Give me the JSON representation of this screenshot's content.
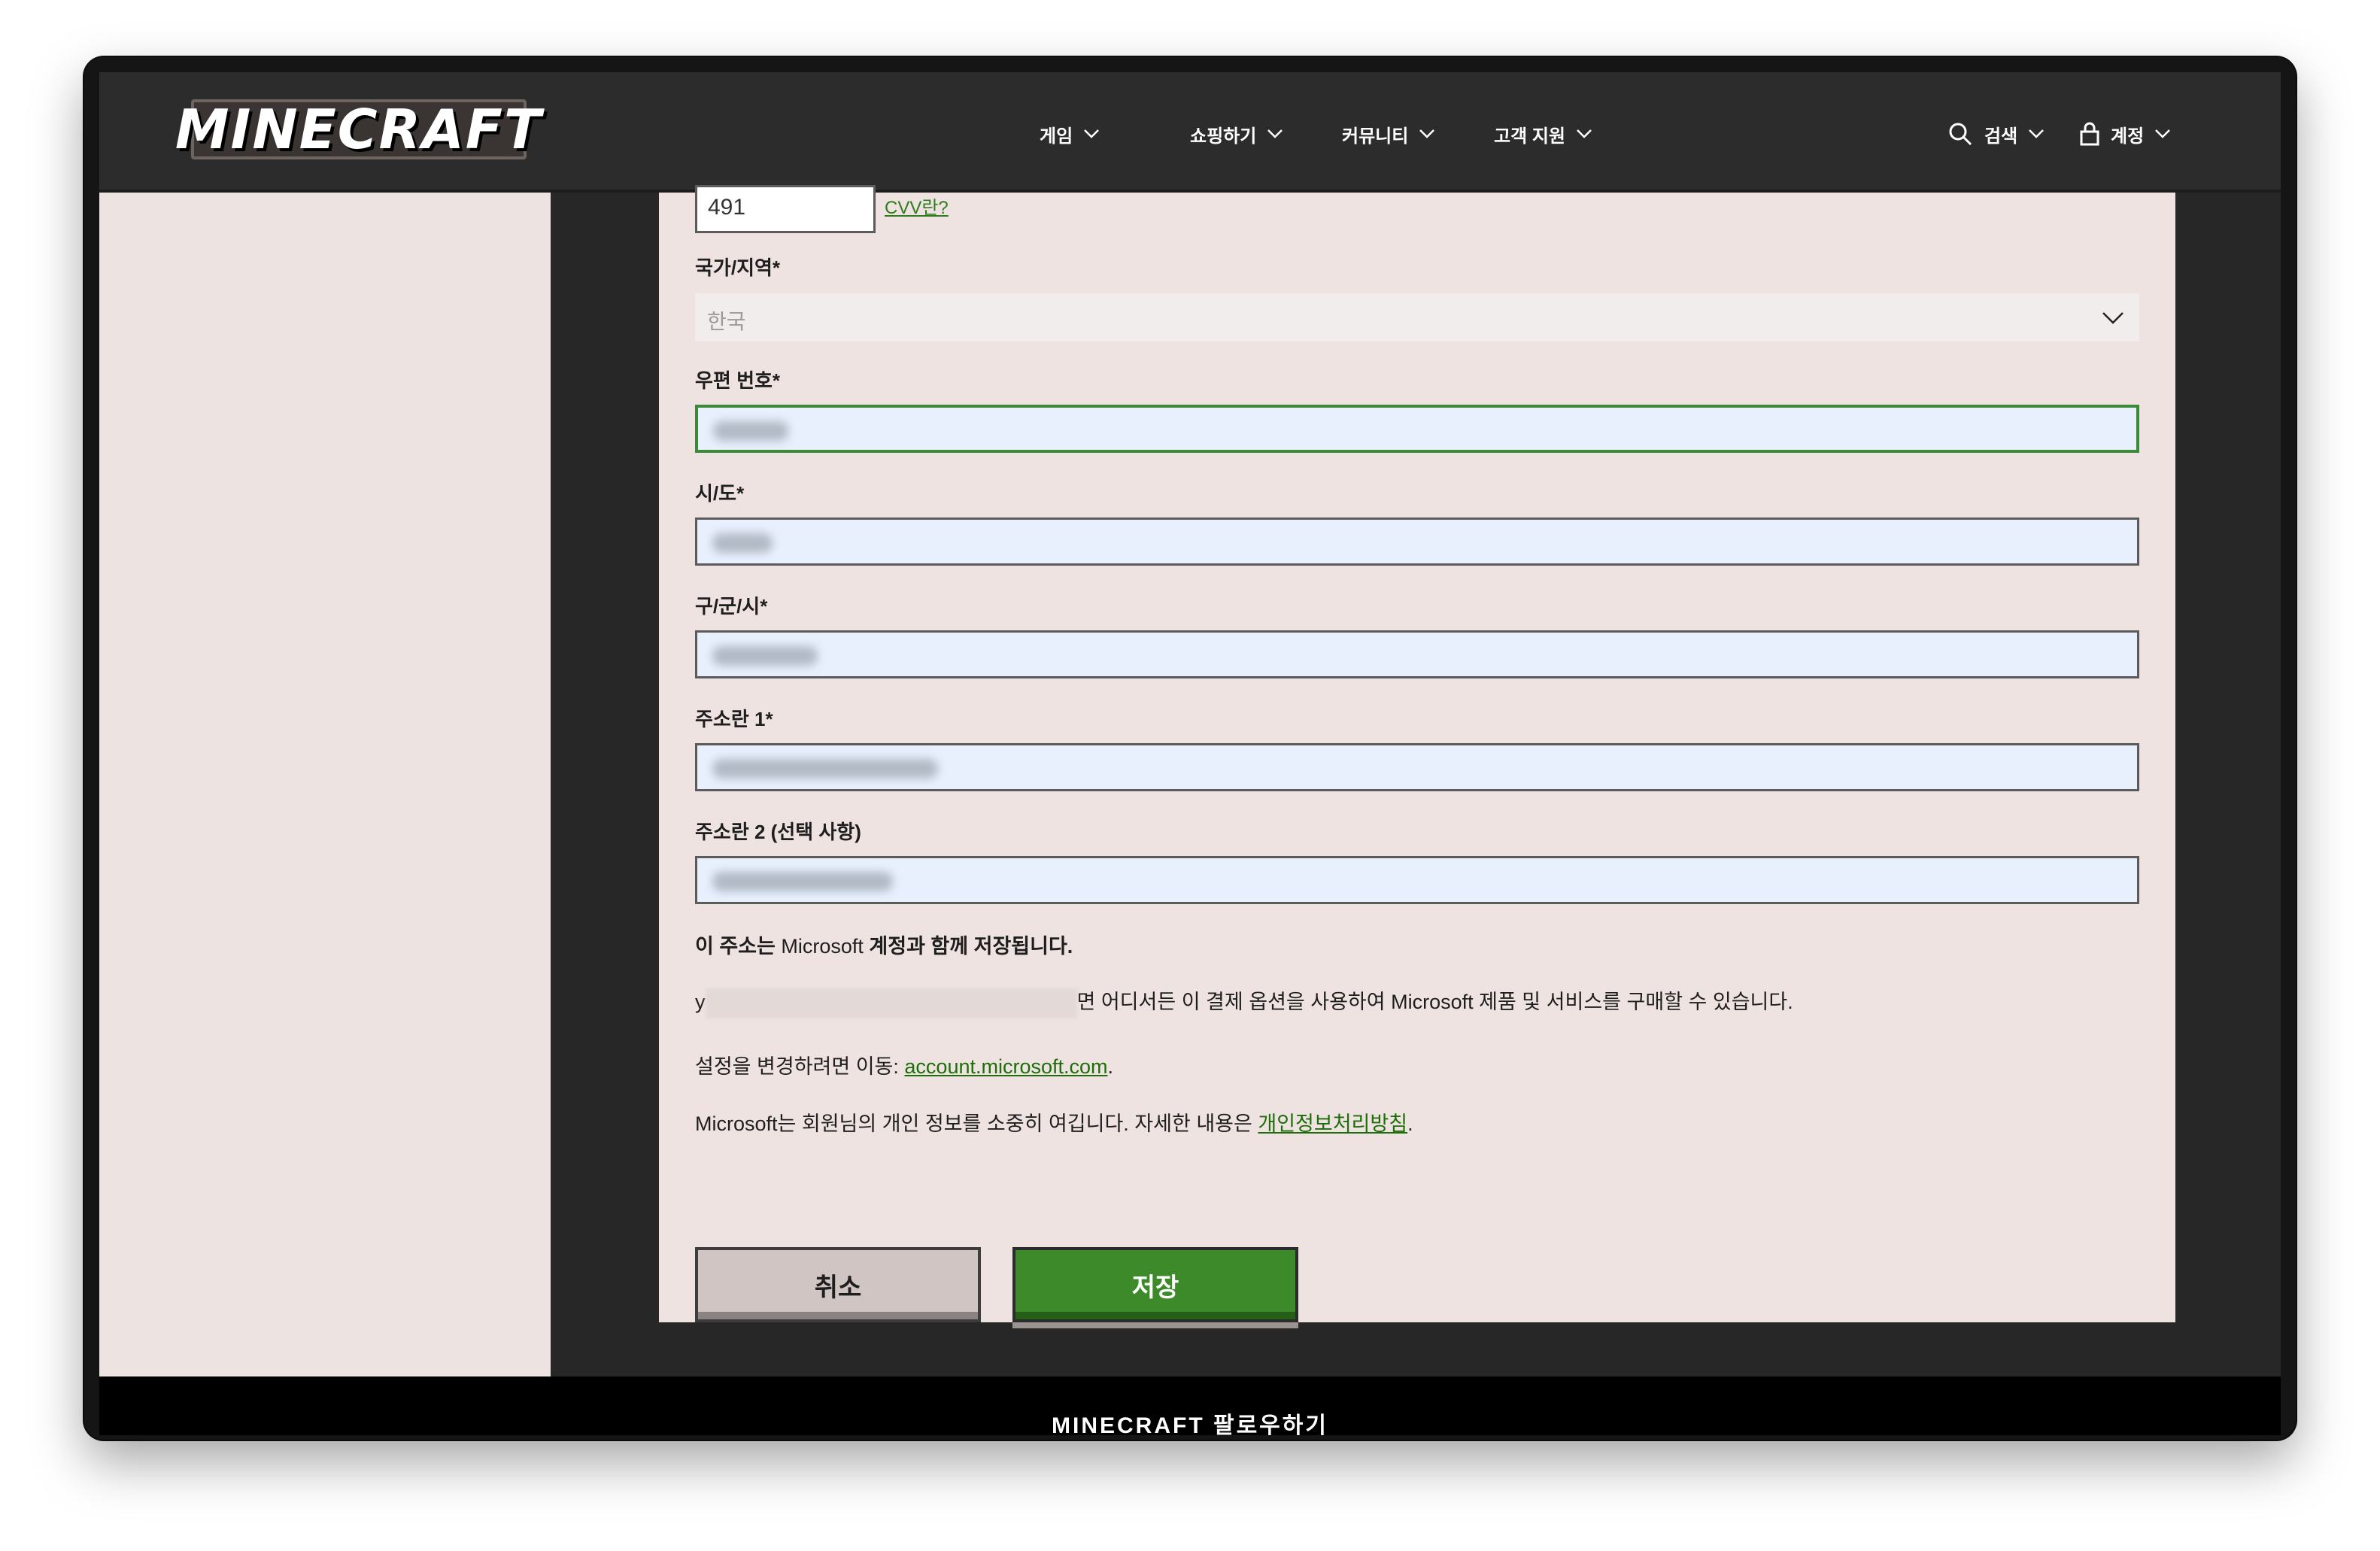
{
  "header": {
    "logo_text": "MINECRAFT",
    "nav": [
      {
        "label": "게임"
      },
      {
        "label": "쇼핑하기"
      },
      {
        "label": "커뮤니티"
      },
      {
        "label": "고객 지원"
      }
    ],
    "search_label": "검색",
    "account_label": "계정"
  },
  "form": {
    "cvv_value": "491",
    "cvv_link": "CVV란?",
    "country_label": "국가/지역*",
    "country_value": "한국",
    "postal_label": "우편 번호*",
    "state_label": "시/도*",
    "city_label": "구/군/시*",
    "address1_label": "주소란 1*",
    "address2_label": "주소란 2 (선택 사항)",
    "save_note_prefix": "이 주소는 ",
    "save_note_brand": "Microsoft",
    "save_note_suffix": " 계정과 함께 저장됩니다.",
    "usage_prefix": "y",
    "usage_text": "면 어디서든 이 결제 옵션을 사용하여 Microsoft 제품 및 서비스를 구매할 수 있습니다.",
    "change_text": "설정을 변경하려면 이동: ",
    "change_link": "account.microsoft.com",
    "change_end": ".",
    "privacy_text": "Microsoft는 회원님의 개인 정보를 소중히 여깁니다. 자세한 내용은 ",
    "privacy_link": "개인정보처리방침",
    "privacy_end": ".",
    "cancel_label": "취소",
    "save_label": "저장"
  },
  "footer": {
    "text": "MINECRAFT 팔로우하기"
  },
  "colors": {
    "accent_green": "#3d8a2b",
    "link_green": "#1d6e0a",
    "header_bg": "#2c2c2c",
    "card_bg": "#efe3e1"
  }
}
